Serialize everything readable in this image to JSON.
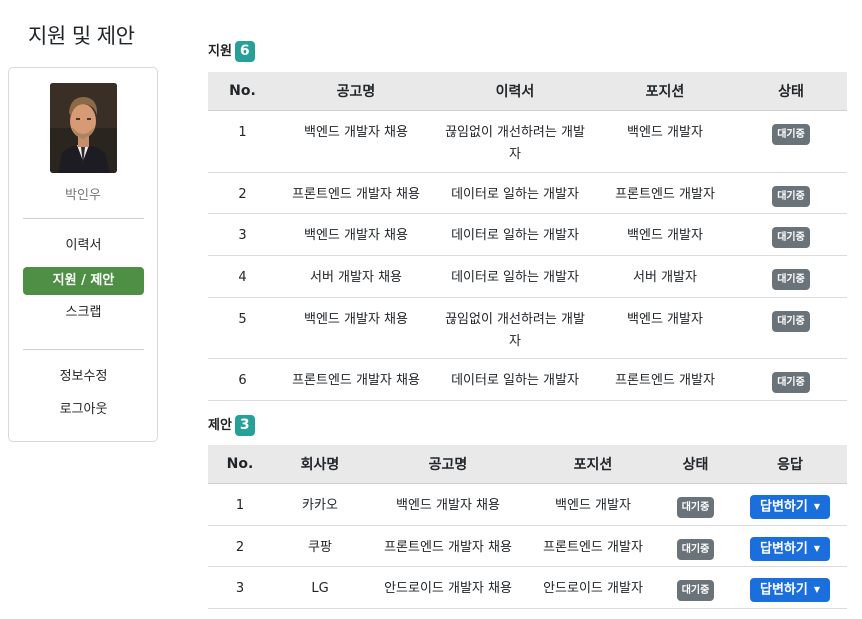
{
  "page_title": "지원 및 제안",
  "profile": {
    "name": "박인우",
    "menu": [
      {
        "label": "이력서"
      },
      {
        "label": "지원 / 제안"
      },
      {
        "label": "스크랩"
      }
    ],
    "account_menu": [
      {
        "label": "정보수정"
      },
      {
        "label": "로그아웃"
      }
    ]
  },
  "applications": {
    "title": "지원",
    "count": "6",
    "columns": [
      "No.",
      "공고명",
      "이력서",
      "포지션",
      "상태"
    ],
    "rows": [
      {
        "no": "1",
        "posting": "백엔드 개발자 채용",
        "resume": "끊임없이 개선하려는 개발자",
        "position": "백엔드 개발자",
        "status": "대기중"
      },
      {
        "no": "2",
        "posting": "프론트엔드 개발자 채용",
        "resume": "데이터로 일하는 개발자",
        "position": "프론트엔드 개발자",
        "status": "대기중"
      },
      {
        "no": "3",
        "posting": "백엔드 개발자 채용",
        "resume": "데이터로 일하는 개발자",
        "position": "백엔드 개발자",
        "status": "대기중"
      },
      {
        "no": "4",
        "posting": "서버 개발자 채용",
        "resume": "데이터로 일하는 개발자",
        "position": "서버 개발자",
        "status": "대기중"
      },
      {
        "no": "5",
        "posting": "백엔드 개발자 채용",
        "resume": "끊임없이 개선하려는 개발자",
        "position": "백엔드 개발자",
        "status": "대기중"
      },
      {
        "no": "6",
        "posting": "프론트엔드 개발자 채용",
        "resume": "데이터로 일하는 개발자",
        "position": "프론트엔드 개발자",
        "status": "대기중"
      }
    ]
  },
  "offers": {
    "title": "제안",
    "count": "3",
    "columns": [
      "No.",
      "회사명",
      "공고명",
      "포지션",
      "상태",
      "응답"
    ],
    "rows": [
      {
        "no": "1",
        "company": "카카오",
        "posting": "백엔드 개발자 채용",
        "position": "백엔드 개발자",
        "status": "대기중",
        "reply": "답변하기"
      },
      {
        "no": "2",
        "company": "쿠팡",
        "posting": "프론트엔드 개발자 채용",
        "position": "프론트엔드 개발자",
        "status": "대기중",
        "reply": "답변하기"
      },
      {
        "no": "3",
        "company": "LG",
        "posting": "안드로이드 개발자 채용",
        "position": "안드로이드 개발자",
        "status": "대기중",
        "reply": "답변하기"
      }
    ]
  }
}
